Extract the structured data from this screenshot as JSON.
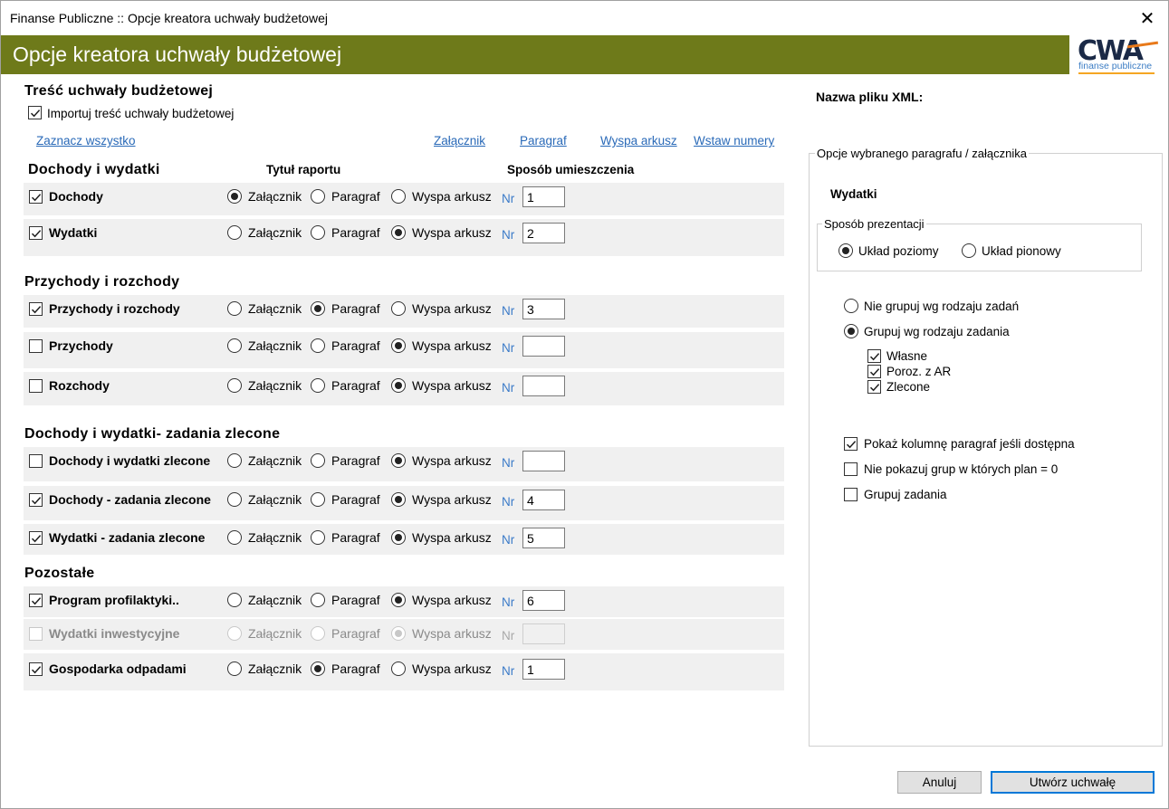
{
  "window": {
    "title": "Finanse Publiczne :: Opcje kreatora uchwały budżetowej",
    "close_glyph": "✕"
  },
  "banner": {
    "title": "Opcje kreatora uchwały budżetowej"
  },
  "logo": {
    "main": "CWA",
    "sub": "finanse publiczne",
    "accent": "#f5a623"
  },
  "colors": {
    "banner_bg": "#6e7a1a",
    "link": "#2a6ab8",
    "row_bg": "#f0f0f0"
  },
  "content": {
    "heading": "Treść uchwały budżetowej",
    "import_label": "Importuj treść uchwały budżetowej",
    "import_checked": true,
    "links": {
      "select_all": "Zaznacz wszystko",
      "attachment": "Załącznik",
      "paragraph": "Paragraf",
      "island": "Wyspa arkusz",
      "insert_numbers": "Wstaw numery"
    },
    "col_title": "Tytuł raportu",
    "col_placement": "Sposób umieszczenia",
    "options": {
      "attachment": "Załącznik",
      "paragraph": "Paragraf",
      "island": "Wyspa arkusz",
      "nr": "Nr"
    },
    "sections": [
      {
        "title": "Dochody i wydatki",
        "rows": [
          {
            "label": "Dochody",
            "checked": true,
            "selected": "attachment",
            "nr": "1"
          },
          {
            "label": "Wydatki",
            "checked": true,
            "selected": "island",
            "nr": "2"
          }
        ]
      },
      {
        "title": "Przychody i rozchody",
        "rows": [
          {
            "label": "Przychody i rozchody",
            "checked": true,
            "selected": "paragraph",
            "nr": "3"
          },
          {
            "label": "Przychody",
            "checked": false,
            "selected": "island",
            "nr": ""
          },
          {
            "label": "Rozchody",
            "checked": false,
            "selected": "island",
            "nr": ""
          }
        ]
      },
      {
        "title": "Dochody i wydatki- zadania zlecone",
        "rows": [
          {
            "label": "Dochody i wydatki zlecone",
            "checked": false,
            "selected": "island",
            "nr": ""
          },
          {
            "label": "Dochody - zadania zlecone",
            "checked": true,
            "selected": "island",
            "nr": "4"
          },
          {
            "label": "Wydatki - zadania zlecone",
            "checked": true,
            "selected": "island",
            "nr": "5"
          }
        ]
      },
      {
        "title": "Pozostałe",
        "rows": [
          {
            "label": "Program profilaktyki..",
            "checked": true,
            "selected": "island",
            "nr": "6"
          },
          {
            "label": "Wydatki inwestycyjne",
            "checked": false,
            "selected": "island",
            "nr": "",
            "disabled": true
          },
          {
            "label": "Gospodarka odpadami",
            "checked": true,
            "selected": "paragraph",
            "nr": "1"
          }
        ]
      }
    ]
  },
  "right": {
    "xml_label": "Nazwa pliku XML:",
    "group_title": "Opcje wybranego paragrafu / załącznika",
    "selected_name": "Wydatki",
    "presentation_title": "Sposób prezentacji",
    "layout_horizontal": "Układ poziomy",
    "layout_vertical": "Układ pionowy",
    "layout_selected": "horizontal",
    "no_group": "Nie grupuj wg rodzaju zadań",
    "group_by_type": "Grupuj wg rodzaju zadania",
    "grouping_selected": "group",
    "task_types": [
      {
        "label": "Własne",
        "checked": true
      },
      {
        "label": "Poroz. z AR",
        "checked": true
      },
      {
        "label": "Zlecone",
        "checked": true
      }
    ],
    "show_paragraph_column": "Pokaż kolumnę paragraf jeśli dostępna",
    "show_paragraph_checked": true,
    "hide_zero_groups": "Nie pokazuj grup w których plan = 0",
    "hide_zero_checked": false,
    "group_tasks": "Grupuj zadania",
    "group_tasks_checked": false
  },
  "buttons": {
    "cancel": "Anuluj",
    "create": "Utwórz uchwałę"
  }
}
